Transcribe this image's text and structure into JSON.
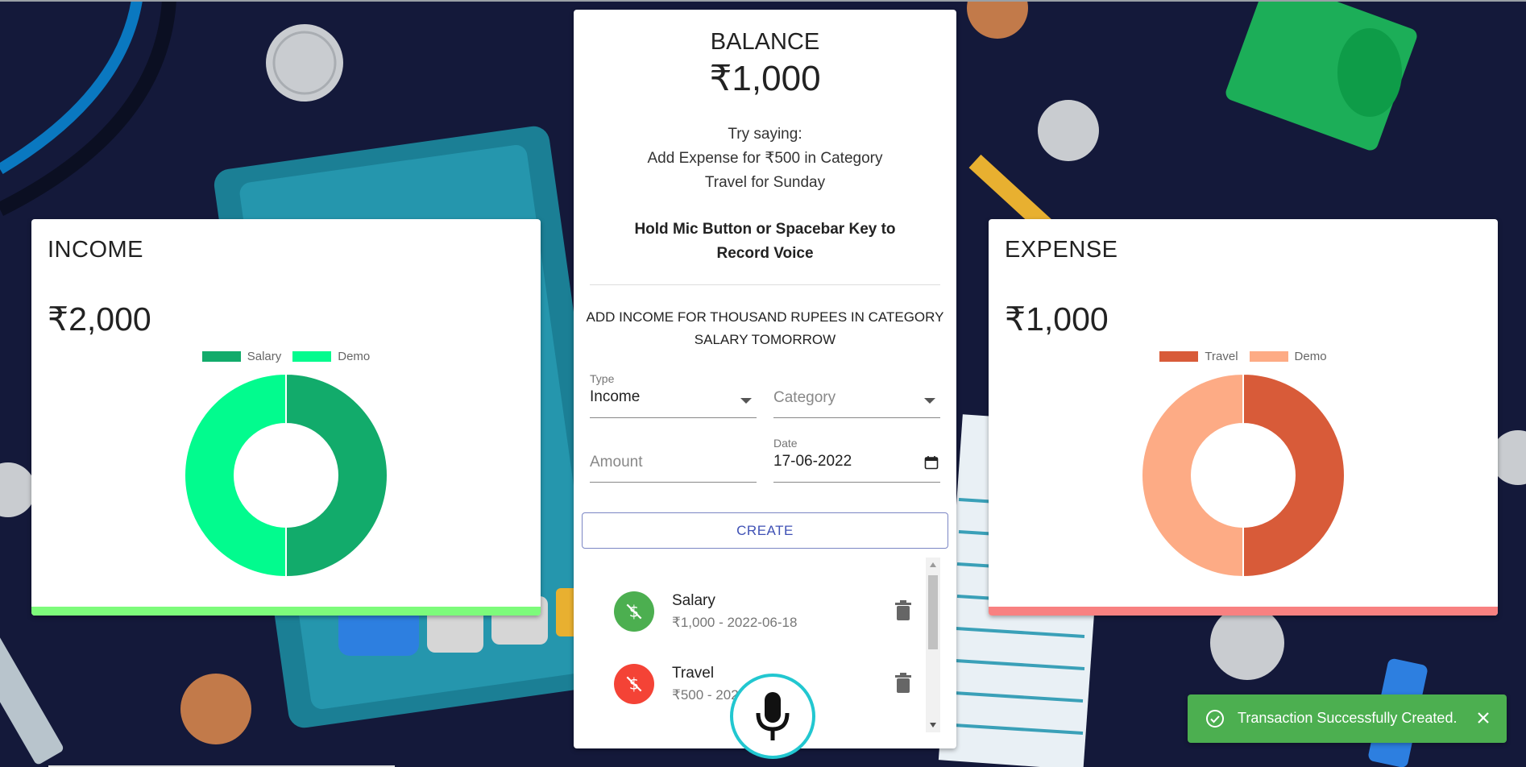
{
  "colors": {
    "background": "#14193a",
    "income_accent": "#7dfb7b",
    "expense_accent": "#f88181",
    "create_button": "#3f51b5",
    "mic_ring": "#22c7d0",
    "snackbar": "#4caf50"
  },
  "income": {
    "title": "INCOME",
    "amount": "₹2,000",
    "legend": [
      {
        "label": "Salary",
        "color": "#12ab6b"
      },
      {
        "label": "Demo",
        "color": "#02fb8e"
      }
    ]
  },
  "expense": {
    "title": "EXPENSE",
    "amount": "₹1,000",
    "legend": [
      {
        "label": "Travel",
        "color": "#d85b39"
      },
      {
        "label": "Demo",
        "color": "#fdab85"
      }
    ]
  },
  "main": {
    "balance_label": "BALANCE",
    "balance_amount": "₹1,000",
    "hint_line1": "Try saying:",
    "hint_line2": "Add Expense for ₹500 in Category",
    "hint_line3": "Travel for Sunday",
    "hold_line1": "Hold Mic Button or Spacebar Key to",
    "hold_line2": "Record Voice",
    "transcript_line1": "ADD INCOME FOR THOUSAND RUPEES IN CATEGORY",
    "transcript_line2": "SALARY TOMORROW",
    "form": {
      "type_label": "Type",
      "type_value": "Income",
      "category_placeholder": "Category",
      "amount_placeholder": "Amount",
      "date_label": "Date",
      "date_value": "17-06-2022",
      "create_label": "CREATE"
    },
    "transactions": [
      {
        "title": "Salary",
        "subtitle": "₹1,000 - 2022-06-18",
        "kind": "income",
        "icon": "money-off-icon"
      },
      {
        "title": "Travel",
        "subtitle": "₹500 - 2022-06-",
        "kind": "expense",
        "icon": "money-off-icon"
      }
    ]
  },
  "snackbar": {
    "message": "Transaction Successfully Created.",
    "icon": "check-circle-icon",
    "close_icon": "close-icon"
  },
  "chart_data": [
    {
      "type": "pie",
      "categories": [
        "Salary",
        "Demo"
      ],
      "values": [
        1000,
        1000
      ],
      "colors": [
        "#12ab6b",
        "#02fb8e"
      ],
      "legend": "top"
    },
    {
      "type": "pie",
      "categories": [
        "Travel",
        "Demo"
      ],
      "values": [
        500,
        500
      ],
      "colors": [
        "#d85b39",
        "#fdab85"
      ],
      "legend": "top"
    }
  ]
}
